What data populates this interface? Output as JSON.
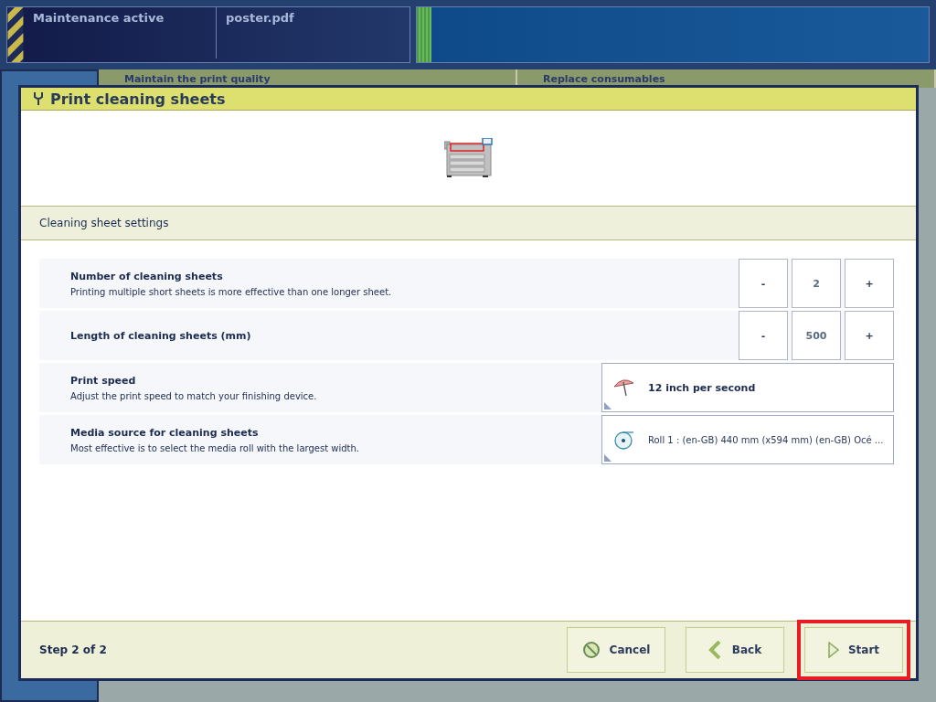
{
  "status_bar": {
    "status": "Maintenance active",
    "job": "poster.pdf"
  },
  "background_tabs": [
    {
      "label": "Maintain the print quality"
    },
    {
      "label": "Replace consumables"
    }
  ],
  "dialog": {
    "title": "Print cleaning sheets",
    "section": "Cleaning sheet settings",
    "settings": [
      {
        "kind": "stepper",
        "label": "Number of cleaning sheets",
        "description": "Printing multiple short sheets is more effective than one longer sheet.",
        "decrement": "-",
        "value": "2",
        "increment": "+"
      },
      {
        "kind": "stepper",
        "label": "Length of cleaning sheets (mm)",
        "decrement": "-",
        "value": "500",
        "increment": "+"
      },
      {
        "kind": "speed",
        "label": "Print speed",
        "description": "Adjust the print speed to match your finishing device.",
        "value": "12 inch per second"
      },
      {
        "kind": "media",
        "label": "Media source for cleaning sheets",
        "description": "Most effective is to select the media roll with the largest width.",
        "value": "Roll 1 : (en-GB) 440 mm (x594 mm) (en-GB) Océ ..."
      }
    ],
    "step": "Step 2 of 2",
    "buttons": [
      {
        "kind": "cancel",
        "label": "Cancel",
        "highlighted": false
      },
      {
        "kind": "back",
        "label": "Back",
        "highlighted": false
      },
      {
        "kind": "start",
        "label": "Start",
        "highlighted": true
      }
    ]
  }
}
